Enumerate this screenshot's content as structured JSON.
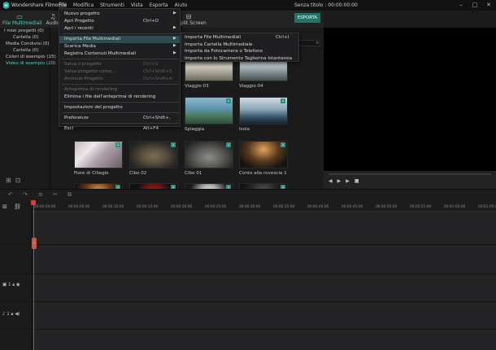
{
  "app": {
    "name": "Wondershare Filmora",
    "doc_title": "Senza titolo : 00:00:00:00",
    "export_label": "ESPORTA"
  },
  "menubar": [
    "File",
    "Modifica",
    "Strumenti",
    "Vista",
    "Esporta",
    "Aiuto"
  ],
  "library": {
    "tabs": [
      {
        "label": "File Multimediali",
        "icon": "folder-icon"
      },
      {
        "label": "Audio",
        "icon": "music-note-icon"
      }
    ],
    "split_screen_label": "Split Screen",
    "folders": [
      {
        "label": "I miei progetti (0)"
      },
      {
        "label": "Cartella (0)"
      },
      {
        "label": "Media Condivisi (0)"
      },
      {
        "label": "Cartella (0)"
      },
      {
        "label": "Colori di esempio (15)"
      },
      {
        "label": "Video di esempio (20)"
      }
    ],
    "search_placeholder": "Ricerca",
    "media": [
      {
        "name": "Viaggio 03",
        "thumb": "t-viaggio3"
      },
      {
        "name": "Viaggio 04",
        "thumb": "t-viaggio4"
      },
      {
        "name": "Spiaggia",
        "thumb": "t-beach"
      },
      {
        "name": "Isola",
        "thumb": "t-isola"
      },
      {
        "name": "Fiore di Ciliegio",
        "thumb": "t-blossom"
      },
      {
        "name": "Cibo 02",
        "thumb": "t-bowl"
      },
      {
        "name": "Cibo 01",
        "thumb": "t-cibo"
      },
      {
        "name": "Conto alla rovescia 1",
        "thumb": "t-clap"
      },
      {
        "name": "",
        "thumb": "t-orange"
      },
      {
        "name": "",
        "thumb": "t-red"
      },
      {
        "name": "",
        "thumb": "t-q"
      },
      {
        "name": "",
        "thumb": "t-dark"
      }
    ]
  },
  "file_menu": {
    "items": [
      {
        "label": "Nuovo progetto",
        "shortcut": "",
        "arrow": true,
        "disabled": false
      },
      {
        "label": "Apri Progetto",
        "shortcut": "Ctrl+O",
        "arrow": false,
        "disabled": false
      },
      {
        "label": "Apri i recenti",
        "shortcut": "",
        "arrow": true,
        "disabled": false
      },
      {
        "label": "Importa File Multimediali",
        "shortcut": "",
        "arrow": true,
        "disabled": false,
        "highlighted": true
      },
      {
        "label": "Scarica Media",
        "shortcut": "",
        "arrow": true,
        "disabled": false
      },
      {
        "label": "Registra Contenuti Multimediali",
        "shortcut": "",
        "arrow": true,
        "disabled": false
      },
      {
        "label": "Salva il progetto",
        "shortcut": "Ctrl+S",
        "arrow": false,
        "disabled": true
      },
      {
        "label": "Salva progetto come...",
        "shortcut": "Ctrl+Shift+S",
        "arrow": false,
        "disabled": true
      },
      {
        "label": "Archivia Progetto",
        "shortcut": "Ctrl+Shift+A",
        "arrow": false,
        "disabled": true
      },
      {
        "label": "Anteprima di rendering",
        "shortcut": "",
        "arrow": false,
        "disabled": true
      },
      {
        "label": "Elimina i file dell'anteprima di rendering",
        "shortcut": "",
        "arrow": false,
        "disabled": false
      },
      {
        "label": "Impostazioni del progetto",
        "shortcut": "",
        "arrow": false,
        "disabled": false
      },
      {
        "label": "Preferenze",
        "shortcut": "Ctrl+Shift+,",
        "arrow": false,
        "disabled": false
      },
      {
        "label": "Esci",
        "shortcut": "Alt+F4",
        "arrow": false,
        "disabled": false
      }
    ]
  },
  "import_submenu": {
    "items": [
      {
        "label": "Importa File Multimediali",
        "shortcut": "Ctrl+I"
      },
      {
        "label": "Importa Cartella Multimediale",
        "shortcut": ""
      },
      {
        "label": "Importa da Fotocamera o Telefono",
        "shortcut": ""
      },
      {
        "label": "Importa con lo Strumento Taglierina Istantanea",
        "shortcut": ""
      }
    ]
  },
  "timeline": {
    "ticks": [
      "00:00:00:00",
      "00:00:05:00",
      "00:00:10:00",
      "00:00:15:00",
      "00:00:20:00",
      "00:00:25:00",
      "00:00:30:00",
      "00:00:35:00",
      "00:00:40:00",
      "00:00:45:00",
      "00:00:50:00",
      "00:00:55:00",
      "00:01:00:00",
      "00:01:05:00"
    ],
    "video_track_label": "1",
    "audio_track_label": "1"
  },
  "colors": {
    "accent": "#4fd1c0",
    "export_button": "#26706a",
    "playhead": "#d83b3b",
    "menu_highlight": "#2e4b52"
  }
}
